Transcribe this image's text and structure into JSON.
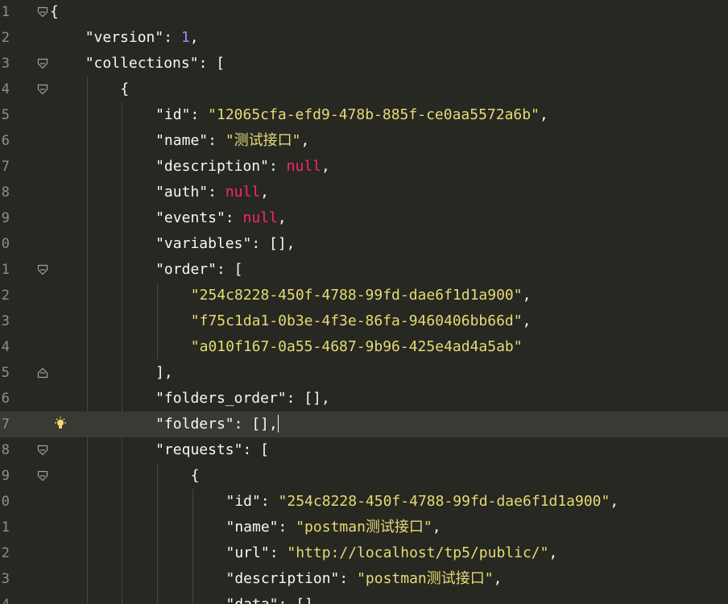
{
  "editor": {
    "line_numbers": [
      "1",
      "2",
      "3",
      "4",
      "5",
      "6",
      "7",
      "8",
      "9",
      "0",
      "1",
      "2",
      "3",
      "4",
      "5",
      "6",
      "7",
      "8",
      "9",
      "0",
      "1",
      "2",
      "3",
      "4"
    ],
    "lines": [
      [
        {
          "c": "p",
          "t": "{"
        }
      ],
      [
        {
          "c": "k",
          "t": "\"version\""
        },
        {
          "c": "p",
          "t": ": "
        },
        {
          "c": "n",
          "t": "1"
        },
        {
          "c": "p",
          "t": ","
        }
      ],
      [
        {
          "c": "k",
          "t": "\"collections\""
        },
        {
          "c": "p",
          "t": ": ["
        }
      ],
      [
        {
          "c": "p",
          "t": "{"
        }
      ],
      [
        {
          "c": "k",
          "t": "\"id\""
        },
        {
          "c": "p",
          "t": ": "
        },
        {
          "c": "s",
          "t": "\"12065cfa-efd9-478b-885f-ce0aa5572a6b\""
        },
        {
          "c": "p",
          "t": ","
        }
      ],
      [
        {
          "c": "k",
          "t": "\"name\""
        },
        {
          "c": "p",
          "t": ": "
        },
        {
          "c": "s",
          "t": "\"测试接口\""
        },
        {
          "c": "p",
          "t": ","
        }
      ],
      [
        {
          "c": "k",
          "t": "\"description\""
        },
        {
          "c": "p",
          "t": ": "
        },
        {
          "c": "nl",
          "t": "null"
        },
        {
          "c": "p",
          "t": ","
        }
      ],
      [
        {
          "c": "k",
          "t": "\"auth\""
        },
        {
          "c": "p",
          "t": ": "
        },
        {
          "c": "nl",
          "t": "null"
        },
        {
          "c": "p",
          "t": ","
        }
      ],
      [
        {
          "c": "k",
          "t": "\"events\""
        },
        {
          "c": "p",
          "t": ": "
        },
        {
          "c": "nl",
          "t": "null"
        },
        {
          "c": "p",
          "t": ","
        }
      ],
      [
        {
          "c": "k",
          "t": "\"variables\""
        },
        {
          "c": "p",
          "t": ": [],"
        }
      ],
      [
        {
          "c": "k",
          "t": "\"order\""
        },
        {
          "c": "p",
          "t": ": ["
        }
      ],
      [
        {
          "c": "s",
          "t": "\"254c8228-450f-4788-99fd-dae6f1d1a900\""
        },
        {
          "c": "p",
          "t": ","
        }
      ],
      [
        {
          "c": "s",
          "t": "\"f75c1da1-0b3e-4f3e-86fa-9460406bb66d\""
        },
        {
          "c": "p",
          "t": ","
        }
      ],
      [
        {
          "c": "s",
          "t": "\"a010f167-0a55-4687-9b96-425e4ad4a5ab\""
        }
      ],
      [
        {
          "c": "p",
          "t": "],"
        }
      ],
      [
        {
          "c": "k",
          "t": "\"folders_order\""
        },
        {
          "c": "p",
          "t": ": [],"
        }
      ],
      [
        {
          "c": "k",
          "t": "\"folders\""
        },
        {
          "c": "p",
          "t": ": [],"
        }
      ],
      [
        {
          "c": "k",
          "t": "\"requests\""
        },
        {
          "c": "p",
          "t": ": ["
        }
      ],
      [
        {
          "c": "p",
          "t": "{"
        }
      ],
      [
        {
          "c": "k",
          "t": "\"id\""
        },
        {
          "c": "p",
          "t": ": "
        },
        {
          "c": "s",
          "t": "\"254c8228-450f-4788-99fd-dae6f1d1a900\""
        },
        {
          "c": "p",
          "t": ","
        }
      ],
      [
        {
          "c": "k",
          "t": "\"name\""
        },
        {
          "c": "p",
          "t": ": "
        },
        {
          "c": "s",
          "t": "\"postman测试接口\""
        },
        {
          "c": "p",
          "t": ","
        }
      ],
      [
        {
          "c": "k",
          "t": "\"url\""
        },
        {
          "c": "p",
          "t": ": "
        },
        {
          "c": "s",
          "t": "\"http://localhost/tp5/public/\""
        },
        {
          "c": "p",
          "t": ","
        }
      ],
      [
        {
          "c": "k",
          "t": "\"description\""
        },
        {
          "c": "p",
          "t": ": "
        },
        {
          "c": "s",
          "t": "\"postman测试接口\""
        },
        {
          "c": "p",
          "t": ","
        }
      ],
      [
        {
          "c": "k",
          "t": "\"data\""
        },
        {
          "c": "p",
          "t": ": [],"
        }
      ]
    ],
    "indent_levels": [
      0,
      1,
      1,
      2,
      3,
      3,
      3,
      3,
      3,
      3,
      3,
      4,
      4,
      4,
      3,
      3,
      3,
      3,
      4,
      5,
      5,
      5,
      5,
      5
    ],
    "fold_markers": [
      "open",
      "",
      "open",
      "open",
      "",
      "",
      "",
      "",
      "",
      "",
      "open",
      "",
      "",
      "",
      "close",
      "",
      "",
      "open",
      "open",
      "",
      "",
      "",
      "",
      ""
    ],
    "active_line_index": 16,
    "lightbulb_line_index": 16,
    "cursor_line_index": 16,
    "colors": {
      "background": "#272822",
      "string": "#e6db74",
      "number": "#ae81ff",
      "null": "#f92672",
      "text": "#f8f8f2",
      "line_number": "#90908a",
      "active_line": "#3a3a34"
    }
  }
}
